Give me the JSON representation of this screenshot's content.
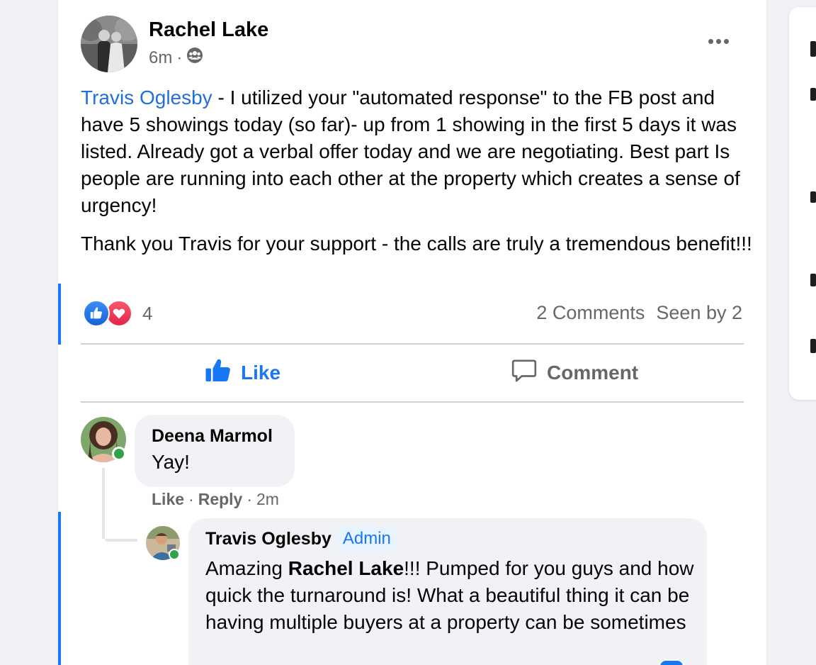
{
  "post": {
    "author": "Rachel Lake",
    "time": "6m",
    "separator": "·",
    "audience_icon": "group-icon",
    "more_icon": "more-options-icon",
    "mention": "Travis Oglesby",
    "paragraph1": " - I utilized your \"automated response\" to the FB post and have 5 showings today (so far)- up from 1 showing in the first 5 days it was listed. Already got a verbal offer today and we are negotiating.  Best part Is people are running into each other at the property which creates a sense of urgency!",
    "paragraph2": "Thank you Travis for your support - the calls are truly a tremendous benefit!!!",
    "reactions": {
      "icons": [
        "like-reaction-icon",
        "love-reaction-icon"
      ],
      "count": "4"
    },
    "comments_count": "2 Comments",
    "seen_by": "Seen by 2",
    "actions": {
      "like": "Like",
      "comment": "Comment"
    }
  },
  "comments": [
    {
      "author": "Deena Marmol",
      "text": "Yay!",
      "like": "Like",
      "reply": "Reply",
      "dot": "·",
      "time": "2m"
    },
    {
      "author": "Travis Oglesby",
      "badge": "Admin",
      "text_prefix": "Amazing ",
      "text_mention": "Rachel Lake",
      "text_suffix": "!!! Pumped for you guys and how quick the turnaround is! What a beautiful thing it can be having multiple buyers at a property can be sometimes"
    }
  ],
  "colors": {
    "accent": "#1877f2",
    "mention": "#216fdb",
    "secondary_text": "#65676b",
    "bubble": "#f0f2f5",
    "online": "#31a24c"
  }
}
